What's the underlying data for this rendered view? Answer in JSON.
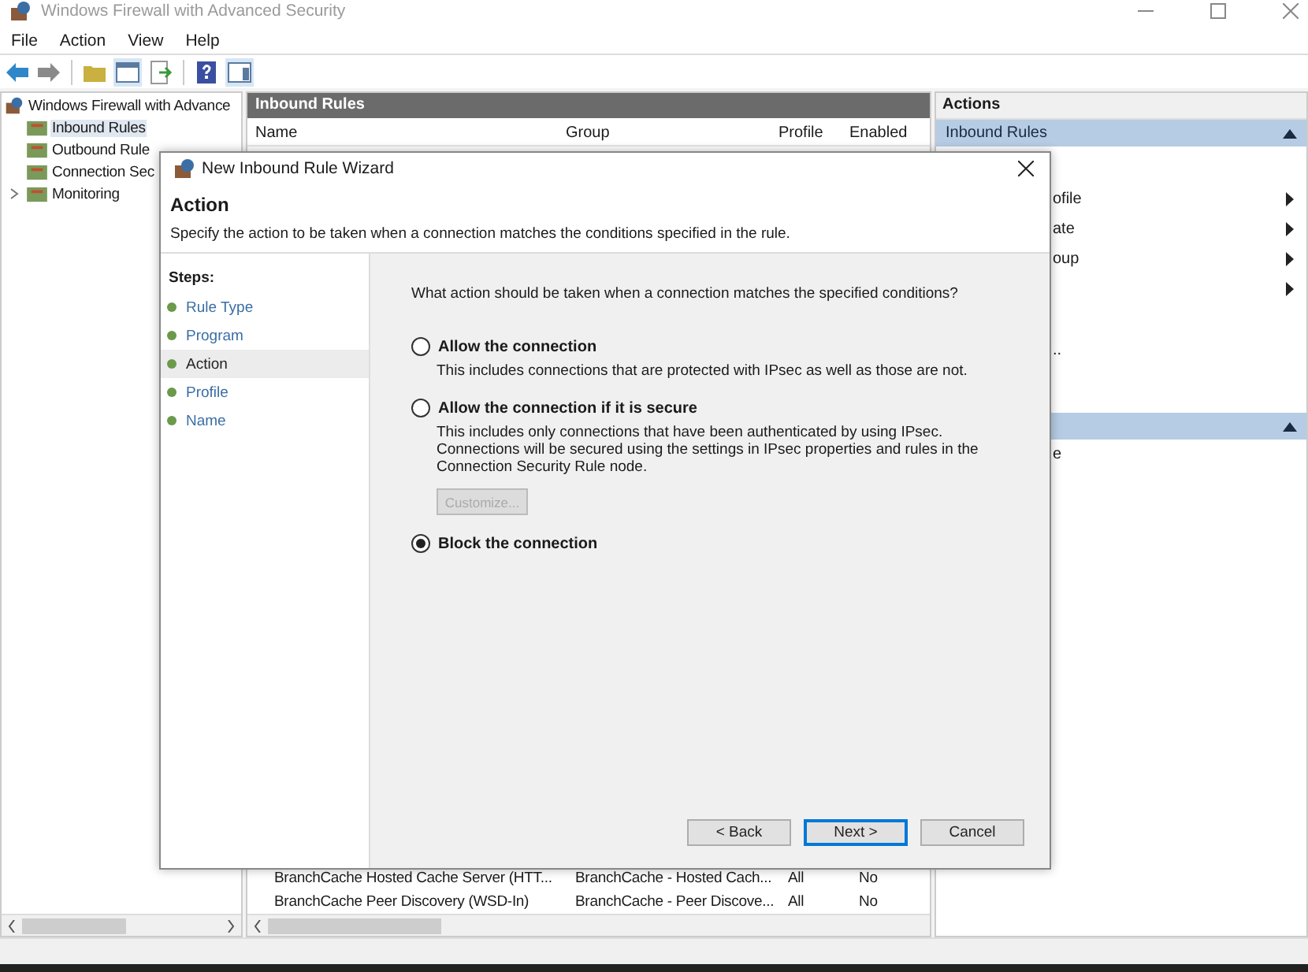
{
  "window": {
    "title": "Windows Firewall with Advanced Security"
  },
  "menu": [
    "File",
    "Action",
    "View",
    "Help"
  ],
  "tree": {
    "label": "Windows Firewall with Advance",
    "children": [
      {
        "label": "Inbound Rules",
        "selected": true,
        "expandable": false
      },
      {
        "label": "Outbound Rule",
        "selected": false,
        "expandable": false
      },
      {
        "label": "Connection Sec",
        "selected": false,
        "expandable": false
      },
      {
        "label": "Monitoring",
        "selected": false,
        "expandable": true
      }
    ]
  },
  "rules_pane": {
    "title": "Inbound Rules",
    "columns": [
      "Name",
      "Group",
      "Profile",
      "Enabled"
    ],
    "rows": [
      [
        "BranchCache Hosted Cache Server (HTT...",
        "BranchCache - Hosted Cach...",
        "All",
        "No"
      ],
      [
        "BranchCache Peer Discovery (WSD-In)",
        "BranchCache - Peer Discove...",
        "All",
        "No"
      ]
    ]
  },
  "actions_pane": {
    "title": "Actions",
    "sections": [
      {
        "title": "Inbound Rules",
        "expanded": true,
        "items": [
          {
            "label": "ofile",
            "submenu": true
          },
          {
            "label": "ate",
            "submenu": true
          },
          {
            "label": "oup",
            "submenu": true
          },
          {
            "submenu": true
          },
          {
            "label": "..",
            "submenu": false
          }
        ]
      },
      {
        "expanded": true,
        "items": [
          {
            "label": "e",
            "submenu": false
          }
        ]
      }
    ]
  },
  "dialog": {
    "title": "New Inbound Rule Wizard",
    "heading": "Action",
    "description": "Specify the action to be taken when a connection matches the conditions specified in the rule.",
    "steps_label": "Steps:",
    "steps": [
      {
        "label": "Rule Type",
        "selected": false
      },
      {
        "label": "Program",
        "selected": false
      },
      {
        "label": "Action",
        "selected": true
      },
      {
        "label": "Profile",
        "selected": false
      },
      {
        "label": "Name",
        "selected": false
      }
    ],
    "question": "What action should be taken when a connection matches the specified conditions?",
    "options": [
      {
        "label": "Allow the connection",
        "note": "This includes connections that are protected with IPsec as well as those are not.",
        "selected": false
      },
      {
        "label": "Allow the connection if it is secure",
        "note": "This includes only connections that have been authenticated by using IPsec.  Connections will be secured using the settings in IPsec properties and rules in the Connection Security Rule node.",
        "selected": false,
        "button": {
          "label": "Customize...",
          "disabled": true
        }
      },
      {
        "label": "Block the connection",
        "selected": true
      }
    ],
    "buttons": [
      {
        "label": "< Back",
        "default": false
      },
      {
        "label": "Next >",
        "default": true
      },
      {
        "label": "Cancel",
        "default": false
      }
    ]
  }
}
